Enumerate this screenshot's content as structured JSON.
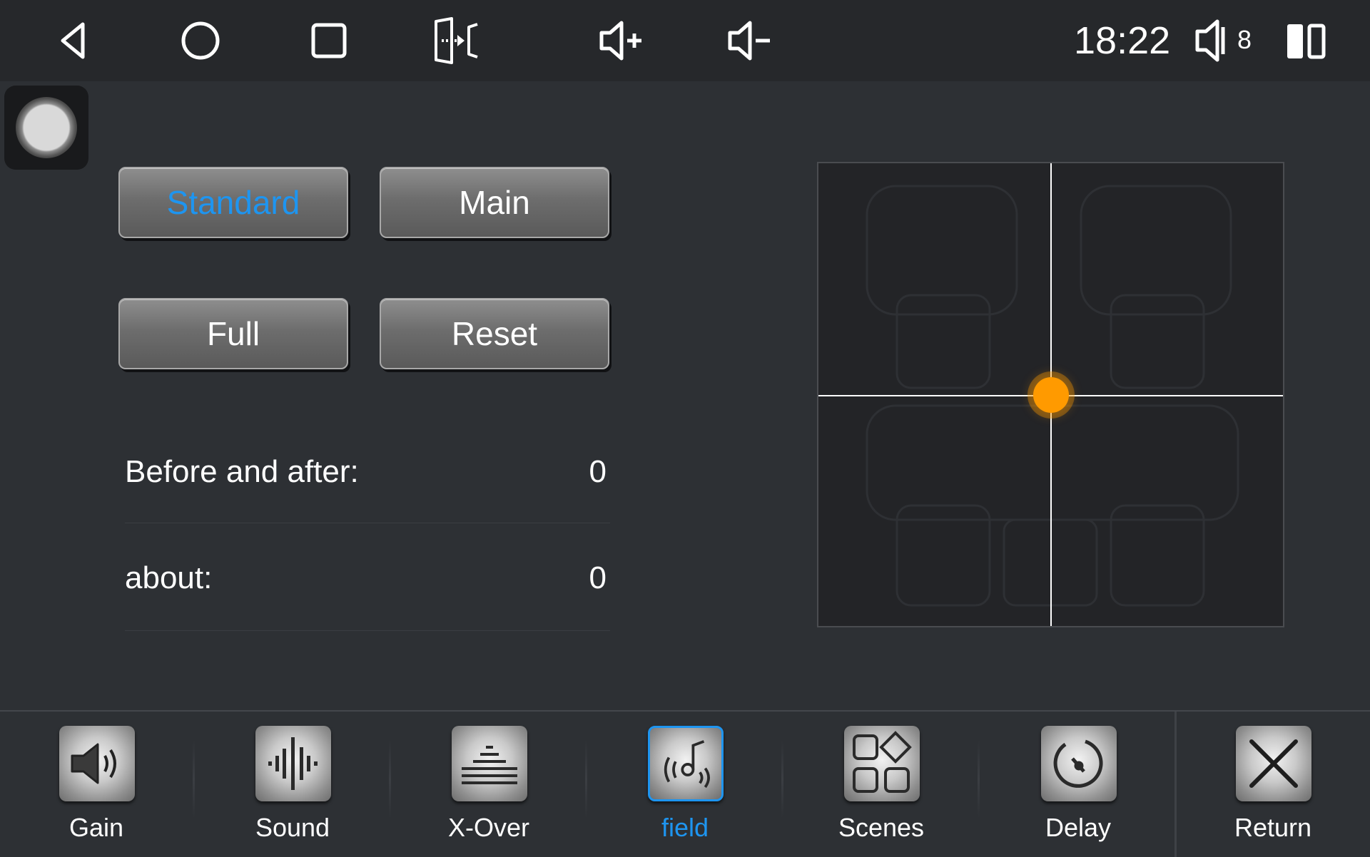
{
  "statusbar": {
    "clock": "18:22",
    "volume_level": "8",
    "nav_icons": [
      "back-icon",
      "home-icon",
      "recents-icon",
      "screen-cast-icon",
      "volume-up-icon",
      "volume-down-icon"
    ]
  },
  "modes": {
    "standard": "Standard",
    "main": "Main",
    "full": "Full",
    "reset": "Reset",
    "active": "standard"
  },
  "settings": {
    "front_rear_label": "Before and after:",
    "front_rear_value": "0",
    "left_right_label": "about:",
    "left_right_value": "0"
  },
  "sound_field": {
    "x": 0,
    "y": 0,
    "knob_color": "#ff9a00"
  },
  "tabs": [
    {
      "label": "Gain",
      "icon": "speaker-gain-icon"
    },
    {
      "label": "Sound",
      "icon": "sound-wave-icon"
    },
    {
      "label": "X-Over",
      "icon": "crossover-icon"
    },
    {
      "label": "field",
      "icon": "sound-field-icon",
      "active": true
    },
    {
      "label": "Scenes",
      "icon": "scenes-icon"
    },
    {
      "label": "Delay",
      "icon": "delay-icon"
    },
    {
      "label": "Return",
      "icon": "close-icon"
    }
  ],
  "colors": {
    "accent": "#1e95f0",
    "background": "#2d3034",
    "statusbar": "#26282b"
  }
}
